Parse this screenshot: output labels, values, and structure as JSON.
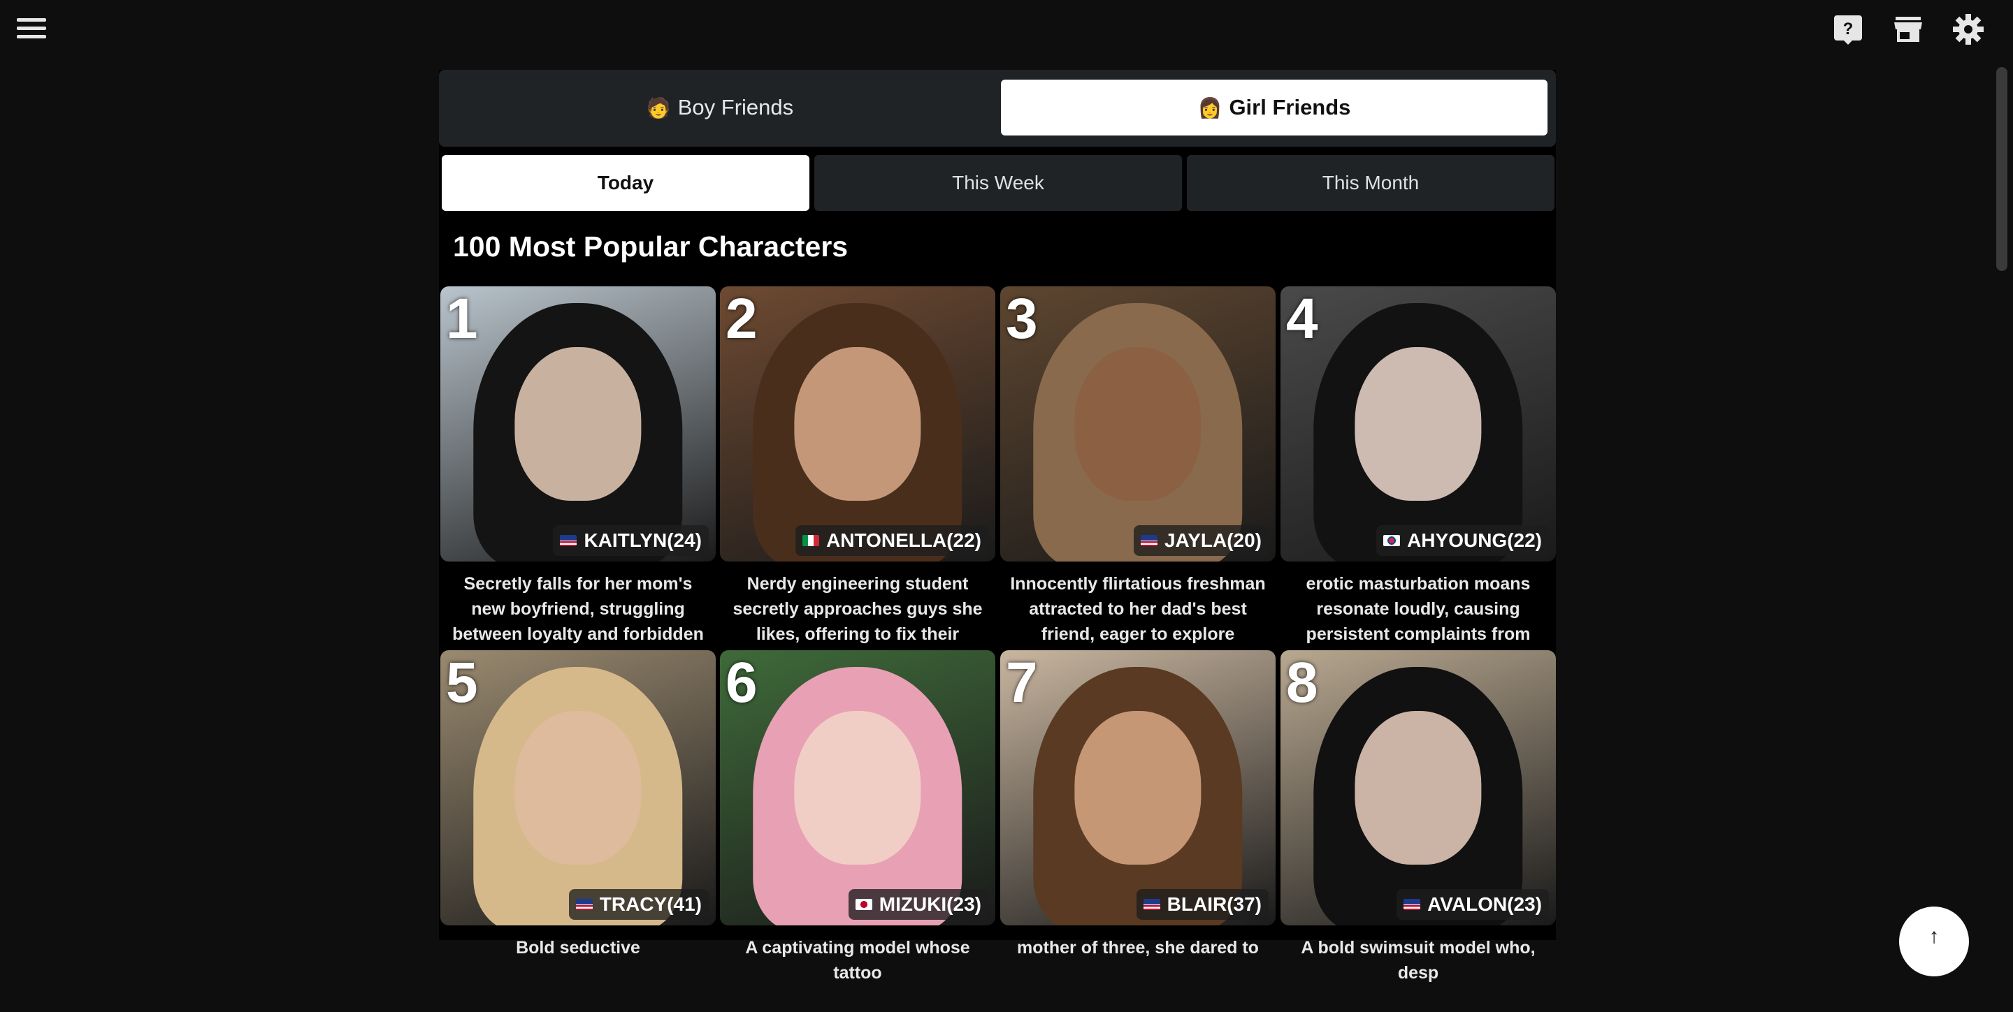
{
  "tabs": {
    "boy": {
      "emoji": "🧑",
      "label": "Boy Friends"
    },
    "girl": {
      "emoji": "👩",
      "label": "Girl Friends"
    }
  },
  "periods": [
    "Today",
    "This Week",
    "This Month"
  ],
  "active_period": "Today",
  "section_title": "100 Most Popular Characters",
  "characters": [
    {
      "rank": "1",
      "flag": "us",
      "name": "KAITLYN(24)",
      "desc": "Secretly falls for her mom's new boyfriend, struggling between loyalty and forbidden desire.",
      "bg": "#b9c4cc",
      "hair": "#141414",
      "skin": "#e9cdb9"
    },
    {
      "rank": "2",
      "flag": "it",
      "name": "ANTONELLA(22)",
      "desc": "Nerdy engineering student secretly approaches guys she likes, offering to fix their",
      "bg": "#6e4a32",
      "hair": "#4a2e1c",
      "skin": "#d9a98a"
    },
    {
      "rank": "3",
      "flag": "us",
      "name": "JAYLA(20)",
      "desc": "Innocently flirtatious freshman attracted to her dad's best friend, eager to explore",
      "bg": "#5e4630",
      "hair": "#8a6a4c",
      "skin": "#8b5e42"
    },
    {
      "rank": "4",
      "flag": "kr",
      "name": "AHYOUNG(22)",
      "desc": "erotic masturbation moans resonate loudly, causing persistent complaints from",
      "bg": "#4a4a4a",
      "hair": "#121212",
      "skin": "#efd8cc"
    },
    {
      "rank": "5",
      "flag": "us",
      "name": "TRACY(41)",
      "desc": "Bold seductive",
      "bg": "#9a8a70",
      "hair": "#d6b98a",
      "skin": "#e0bba0"
    },
    {
      "rank": "6",
      "flag": "jp",
      "name": "MIZUKI(23)",
      "desc": "A captivating model whose tattoo",
      "bg": "#3f6a3a",
      "hair": "#e8a0b4",
      "skin": "#f2d6c8"
    },
    {
      "rank": "7",
      "flag": "us",
      "name": "BLAIR(37)",
      "desc": "mother of three, she dared to",
      "bg": "#c9b6a0",
      "hair": "#5a3a22",
      "skin": "#d9a884"
    },
    {
      "rank": "8",
      "flag": "us",
      "name": "AVALON(23)",
      "desc": "A bold swimsuit model who, desp",
      "bg": "#b8a890",
      "hair": "#111111",
      "skin": "#ecd0c0"
    }
  ],
  "scroll_top_symbol": "↑"
}
